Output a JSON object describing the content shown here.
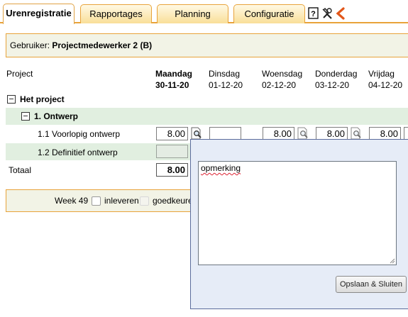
{
  "tabs": [
    {
      "label": "Urenregistratie",
      "active": true
    },
    {
      "label": "Rapportages",
      "active": false
    },
    {
      "label": "Planning",
      "active": false
    },
    {
      "label": "Configuratie",
      "active": false
    }
  ],
  "toolbar_icons": [
    "help-icon",
    "tools-icon",
    "logout-icon"
  ],
  "user": {
    "label": "Gebruiker:",
    "name": "Projectmedewerker 2 (B)"
  },
  "table": {
    "project_header": "Project",
    "days": [
      {
        "name": "Maandag",
        "date": "30-11-20",
        "current": true
      },
      {
        "name": "Dinsdag",
        "date": "01-12-20",
        "current": false
      },
      {
        "name": "Woensdag",
        "date": "02-12-20",
        "current": false
      },
      {
        "name": "Donderdag",
        "date": "03-12-20",
        "current": false
      },
      {
        "name": "Vrijdag",
        "date": "04-12-20",
        "current": false
      }
    ],
    "project_name": "Het project",
    "phase_name": "1. Ontwerp",
    "rows": [
      {
        "label": "1.1 Voorlopig ontwerp",
        "values": [
          "8.00",
          "",
          "8.00",
          "8.00",
          "8.00"
        ]
      },
      {
        "label": "1.2 Definitief ontwerp",
        "values": [
          "",
          "",
          "",
          "",
          ""
        ]
      }
    ],
    "total_label": "Totaal",
    "total_values": [
      "8.00"
    ]
  },
  "footer": {
    "week": "Week 49",
    "submit_label": "inleveren",
    "approve_label": "goedkeure"
  },
  "popup": {
    "comment_text": "opmerking",
    "save_button": "Opslaan & Sluiten"
  },
  "colors": {
    "tab_border": "#e8a33a",
    "tab_fill": "#f9df98",
    "row_green": "#e1efe0",
    "popup_bg": "#e6ecf7"
  }
}
